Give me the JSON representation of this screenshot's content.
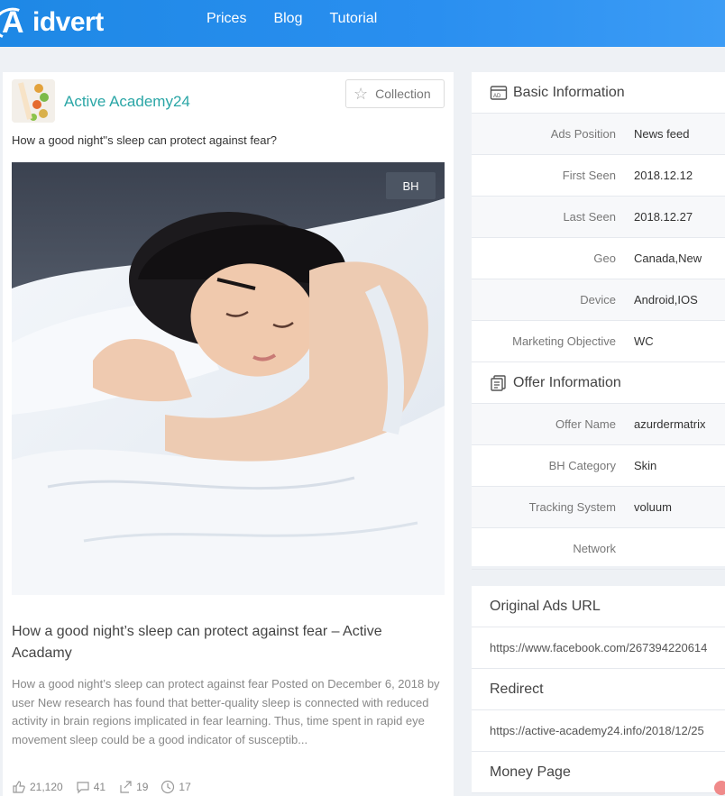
{
  "brand": {
    "mark": "A",
    "name": "idvert"
  },
  "nav": {
    "items": [
      "Prices",
      "Blog",
      "Tutorial"
    ]
  },
  "advertiser": {
    "name": "Active Academy24"
  },
  "collection_label": "Collection",
  "headline": "How a good night''s sleep can protect against fear?",
  "badge": "BH",
  "link_title": "How a good night’s sleep can protect against fear – Active Acadamy",
  "link_desc": "How a good night’s sleep can protect against fear Posted on December 6, 2018 by user New research has found that better-quality sleep is connected with reduced activity in brain regions implicated in fear learning. Thus, time spent in rapid eye movement sleep could be a good indicator of susceptib...",
  "stats": {
    "likes": "21,120",
    "comments": "41",
    "shares": "19",
    "days": "17"
  },
  "basic": {
    "title": "Basic Information",
    "rows": [
      {
        "k": "Ads Position",
        "v": "News feed"
      },
      {
        "k": "First Seen",
        "v": "2018.12.12"
      },
      {
        "k": "Last Seen",
        "v": "2018.12.27"
      },
      {
        "k": "Geo",
        "v": "Canada,New"
      },
      {
        "k": "Device",
        "v": "Android,IOS"
      },
      {
        "k": "Marketing Objective",
        "v": "WC"
      }
    ]
  },
  "offer": {
    "title": "Offer Information",
    "rows": [
      {
        "k": "Offer Name",
        "v": "azurdermatrix"
      },
      {
        "k": "BH Category",
        "v": "Skin"
      },
      {
        "k": "Tracking System",
        "v": "voluum"
      },
      {
        "k": "Network",
        "v": ""
      }
    ]
  },
  "original_url": {
    "title": "Original Ads URL",
    "value": "https://www.facebook.com/267394220614"
  },
  "redirect": {
    "title": "Redirect",
    "value": "https://active-academy24.info/2018/12/25"
  },
  "money_page": {
    "title": "Money Page"
  }
}
